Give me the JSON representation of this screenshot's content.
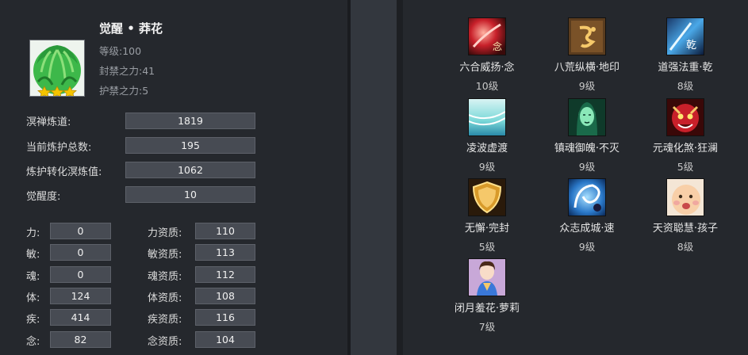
{
  "character": {
    "name": "觉醒 • 莽花",
    "level": "等级:100",
    "seal_power": "封禁之力:41",
    "guard_power": "护禁之力:5"
  },
  "stats": [
    {
      "label": "溟禅炼道:",
      "value": "1819"
    },
    {
      "label": "当前炼护总数:",
      "value": "195"
    },
    {
      "label": "炼护转化溟炼值:",
      "value": "1062"
    },
    {
      "label": "觉醒度:",
      "value": "10"
    }
  ],
  "attributes": [
    {
      "label": "力:",
      "value": "0",
      "apt_label": "力资质:",
      "apt_value": "110"
    },
    {
      "label": "敏:",
      "value": "0",
      "apt_label": "敏资质:",
      "apt_value": "113"
    },
    {
      "label": "魂:",
      "value": "0",
      "apt_label": "魂资质:",
      "apt_value": "112"
    },
    {
      "label": "体:",
      "value": "124",
      "apt_label": "体资质:",
      "apt_value": "108"
    },
    {
      "label": "疾:",
      "value": "414",
      "apt_label": "疾资质:",
      "apt_value": "116"
    },
    {
      "label": "念:",
      "value": "82",
      "apt_label": "念资质:",
      "apt_value": "104"
    }
  ],
  "skills": [
    {
      "name": "六合威扬·念",
      "level": "10级",
      "icon": "red-flame-icon"
    },
    {
      "name": "八荒纵横·地印",
      "level": "9级",
      "icon": "golden-rune-icon"
    },
    {
      "name": "道强法重·乾",
      "level": "8级",
      "icon": "blue-slash-icon"
    },
    {
      "name": "凌波虚渡",
      "level": "9级",
      "icon": "water-wave-icon"
    },
    {
      "name": "镇魂御魄·不灭",
      "level": "9级",
      "icon": "green-spirit-icon"
    },
    {
      "name": "元魂化煞·狂澜",
      "level": "5级",
      "icon": "demon-mask-icon"
    },
    {
      "name": "无懈·完封",
      "level": "5级",
      "icon": "golden-shield-icon"
    },
    {
      "name": "众志成城·速",
      "level": "9级",
      "icon": "blue-swirl-icon"
    },
    {
      "name": "天资聪慧·孩子",
      "level": "8级",
      "icon": "baby-face-icon"
    },
    {
      "name": "闭月羞花·萝莉",
      "level": "7级",
      "icon": "girl-portrait-icon"
    }
  ],
  "colors": {
    "panel_bg": "#25282d",
    "value_box": "#474b53",
    "text": "#dcdcdc",
    "star": "#f5c400"
  }
}
